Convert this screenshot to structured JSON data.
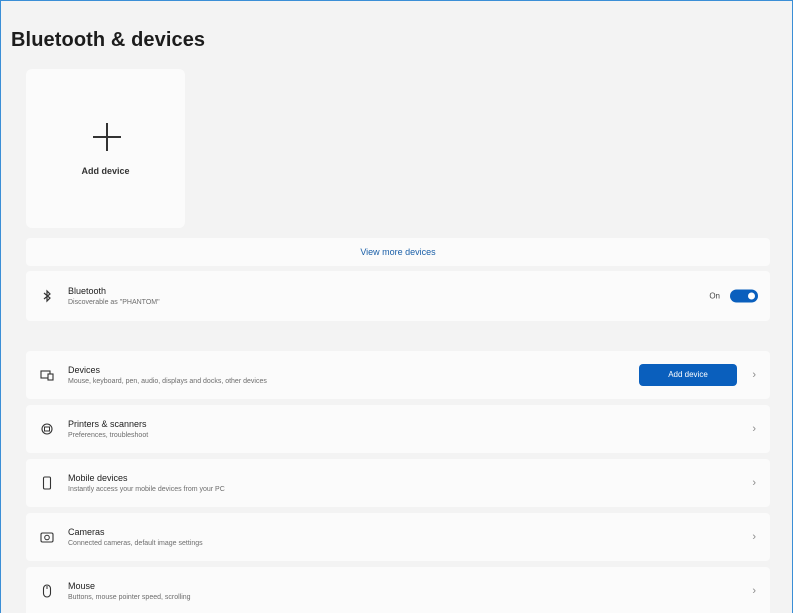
{
  "page": {
    "title": "Bluetooth & devices"
  },
  "add_card": {
    "label": "Add device"
  },
  "view_more": {
    "label": "View more devices"
  },
  "bluetooth": {
    "title": "Bluetooth",
    "subtitle": "Discoverable as \"PHANTOM\"",
    "state": "On",
    "enabled": true
  },
  "rows": [
    {
      "title": "Devices",
      "subtitle": "Mouse, keyboard, pen, audio, displays and docks, other devices",
      "button": "Add device"
    },
    {
      "title": "Printers & scanners",
      "subtitle": "Preferences, troubleshoot"
    },
    {
      "title": "Mobile devices",
      "subtitle": "Instantly access your mobile devices from your PC"
    },
    {
      "title": "Cameras",
      "subtitle": "Connected cameras, default image settings"
    },
    {
      "title": "Mouse",
      "subtitle": "Buttons, mouse pointer speed, scrolling"
    }
  ],
  "colors": {
    "accent": "#0a5fbd",
    "background": "#f3f3f3",
    "card": "#fbfbfb"
  }
}
